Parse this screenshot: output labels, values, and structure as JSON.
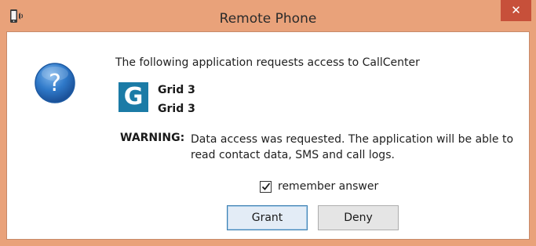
{
  "window": {
    "title": "Remote Phone",
    "close_label": "✕",
    "app_icon": "phone-speaker-icon",
    "accent_color": "#e9a27a",
    "close_color": "#c7503a"
  },
  "dialog": {
    "icon": "question-icon",
    "prompt": "The following application requests access to CallCenter",
    "app_logo_letter": "G",
    "app_logo_color": "#1b7ba6",
    "app_name": "Grid 3",
    "app_subtitle": "Grid 3",
    "warning_label": "WARNING:",
    "warning_text": "Data access was requested. The application will be able to read contact data, SMS and call logs.",
    "remember_checked": true,
    "remember_label": "remember answer"
  },
  "buttons": {
    "grant": "Grant",
    "deny": "Deny"
  }
}
